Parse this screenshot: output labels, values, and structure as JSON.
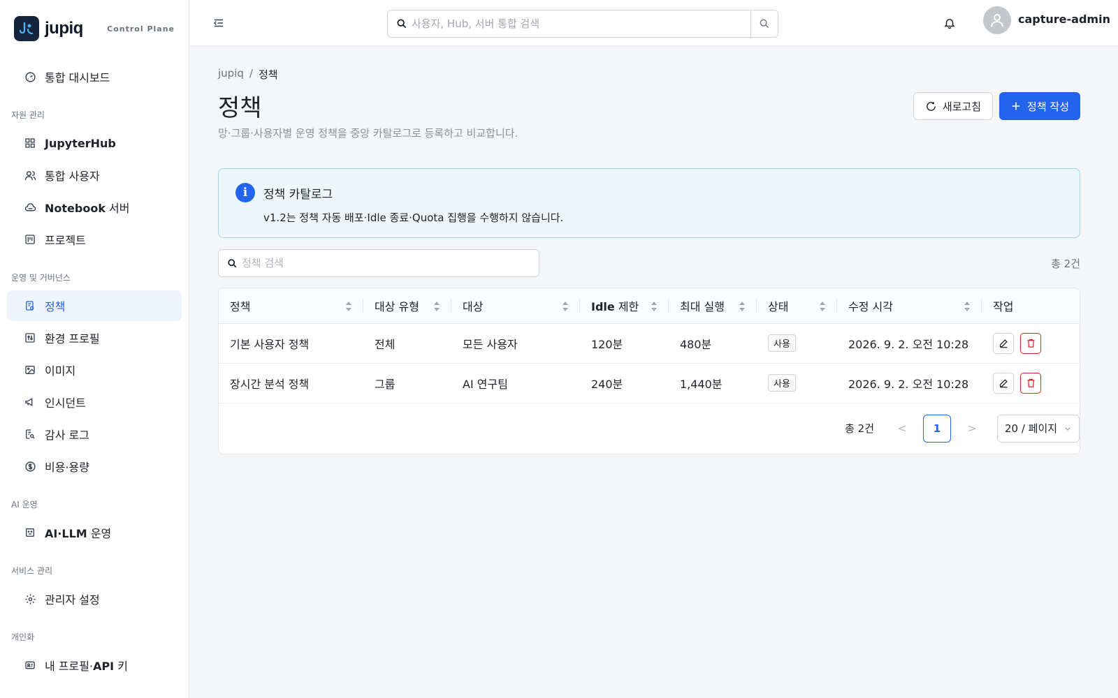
{
  "brand": {
    "name": "jupiq",
    "subtitle": "Control Plane"
  },
  "header": {
    "search_placeholder": "사용자, Hub, 서버 통합 검색",
    "username": "capture-admin"
  },
  "sidebar": {
    "dashboard": "통합 대시보드",
    "sections": {
      "resources": "자원 관리",
      "ops": "운영 및 거버넌스",
      "ai": "AI 운영",
      "service": "서비스 관리",
      "personal": "개인화"
    },
    "items": {
      "jupyterhub": "JupyterHub",
      "users": "통합 사용자",
      "notebook_bold": "Notebook",
      "notebook_rest": " 서버",
      "projects": "프로젝트",
      "policy": "정책",
      "env_profiles": "환경 프로필",
      "images": "이미지",
      "incidents": "인시던트",
      "audit_log": "감사 로그",
      "cost": "비용·용량",
      "ai_bold": "AI·LLM",
      "ai_rest": " 운영",
      "admin_settings": "관리자 설정",
      "profile_a": "내 프로필·",
      "profile_b": "API",
      "profile_c": " 키"
    }
  },
  "breadcrumb": {
    "root": "jupiq",
    "sep": "/",
    "current": "정책"
  },
  "page": {
    "title": "정책",
    "description": "망·그룹·사용자별 운영 정책을 중앙 카탈로그로 등록하고 비교합니다.",
    "refresh_label": "새로고침",
    "create_label": "정책 작성"
  },
  "info": {
    "title": "정책 카탈로그",
    "text": "v1.2는 정책 자동 배포·Idle 종료·Quota 집행을 수행하지 않습니다."
  },
  "filter": {
    "placeholder": "정책 검색",
    "total": "총 2건"
  },
  "table": {
    "headers": {
      "policy": "정책",
      "target_type": "대상 유형",
      "target": "대상",
      "idle_bold": "Idle",
      "idle_rest": " 제한",
      "max_run": "최대 실행",
      "status": "상태",
      "modified": "수정 시각",
      "actions": "작업"
    },
    "rows": [
      {
        "policy": "기본 사용자 정책",
        "target_type": "전체",
        "target": "모든 사용자",
        "idle": "120분",
        "max_run": "480분",
        "status": "사용",
        "modified": "2026. 9. 2. 오전 10:28"
      },
      {
        "policy": "장시간 분석 정책",
        "target_type": "그룹",
        "target": "AI 연구팀",
        "idle": "240분",
        "max_run": "1,440분",
        "status": "사용",
        "modified": "2026. 9. 2. 오전 10:28"
      }
    ]
  },
  "pagination": {
    "total": "총 2건",
    "prev": "<",
    "page": "1",
    "next": ">",
    "page_size": "20 / 페이지"
  },
  "colors": {
    "primary": "#2463eb",
    "active_bg": "#eef3fd",
    "info_bg": "#eef7fd",
    "info_border": "#9fd5ee",
    "danger": "#dc2626"
  }
}
